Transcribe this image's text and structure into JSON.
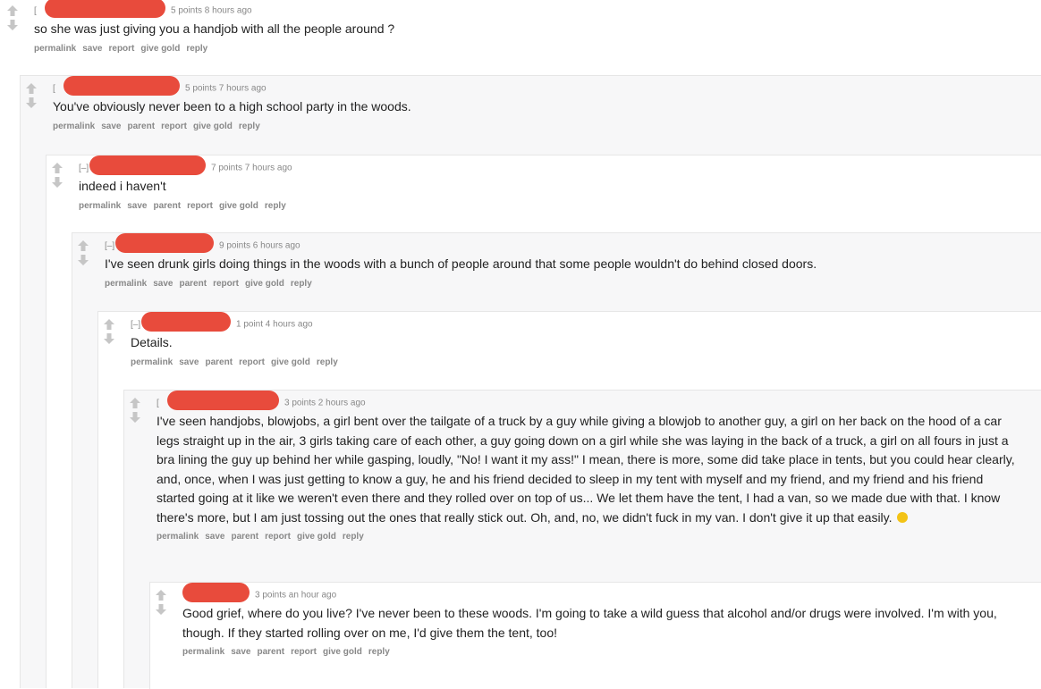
{
  "toggle_label": "[–]",
  "collapsed_toggle": "[",
  "colors": {
    "redact": "#e84b3c",
    "meta": "#888888",
    "arrow": "#c6c6c6"
  },
  "icons": {
    "up": "upvote-arrow-icon",
    "down": "downvote-arrow-icon",
    "emoji": "smiley-emoji"
  },
  "comments": [
    {
      "score_time": "5 points 8 hours ago",
      "body": "so she was just giving you a handjob with all the people around ?",
      "actions": [
        "permalink",
        "save",
        "report",
        "give gold",
        "reply"
      ]
    },
    {
      "score_time": "5 points 7 hours ago",
      "body": "You've obviously never been to a high school party in the woods.",
      "actions": [
        "permalink",
        "save",
        "parent",
        "report",
        "give gold",
        "reply"
      ]
    },
    {
      "score_time": "7 points 7 hours ago",
      "body": "indeed i haven't",
      "actions": [
        "permalink",
        "save",
        "parent",
        "report",
        "give gold",
        "reply"
      ]
    },
    {
      "score_time": "9 points 6 hours ago",
      "body": "I've seen drunk girls doing things in the woods with a bunch of people around that some people wouldn't do behind closed doors.",
      "actions": [
        "permalink",
        "save",
        "parent",
        "report",
        "give gold",
        "reply"
      ]
    },
    {
      "score_time": "1 point 4 hours ago",
      "body": "Details.",
      "actions": [
        "permalink",
        "save",
        "parent",
        "report",
        "give gold",
        "reply"
      ]
    },
    {
      "score_time": "3 points 2 hours ago",
      "body": "I've seen handjobs, blowjobs, a girl bent over the tailgate of a truck by a guy while giving a blowjob to another guy, a girl on her back on the hood of a car legs straight up in the air, 3 girls taking care of each other, a guy going down on a girl while she was laying in the back of a truck, a girl on all fours in just a bra lining the guy up behind her while gasping, loudly, \"No! I want it my ass!\" I mean, there is more, some did take place in tents, but you could hear clearly, and, once, when I was just getting to know a guy, he and his friend decided to sleep in my tent with myself and my friend, and my friend and his friend started going at it like we weren't even there and they rolled over on top of us... We let them have the tent, I had a van, so we made due with that. I know there's more, but I am just tossing out the ones that really stick out. Oh, and, no, we didn't fuck in my van. I don't give it up that easily.",
      "actions": [
        "permalink",
        "save",
        "parent",
        "report",
        "give gold",
        "reply"
      ]
    },
    {
      "score_time": "3 points an hour ago",
      "body": "Good grief, where do you live? I've never been to these woods. I'm going to take a wild guess that alcohol and/or drugs were involved. I'm with you, though. If they started rolling over on me, I'd give them the tent, too!",
      "actions": [
        "permalink",
        "save",
        "parent",
        "report",
        "give gold",
        "reply"
      ]
    }
  ]
}
